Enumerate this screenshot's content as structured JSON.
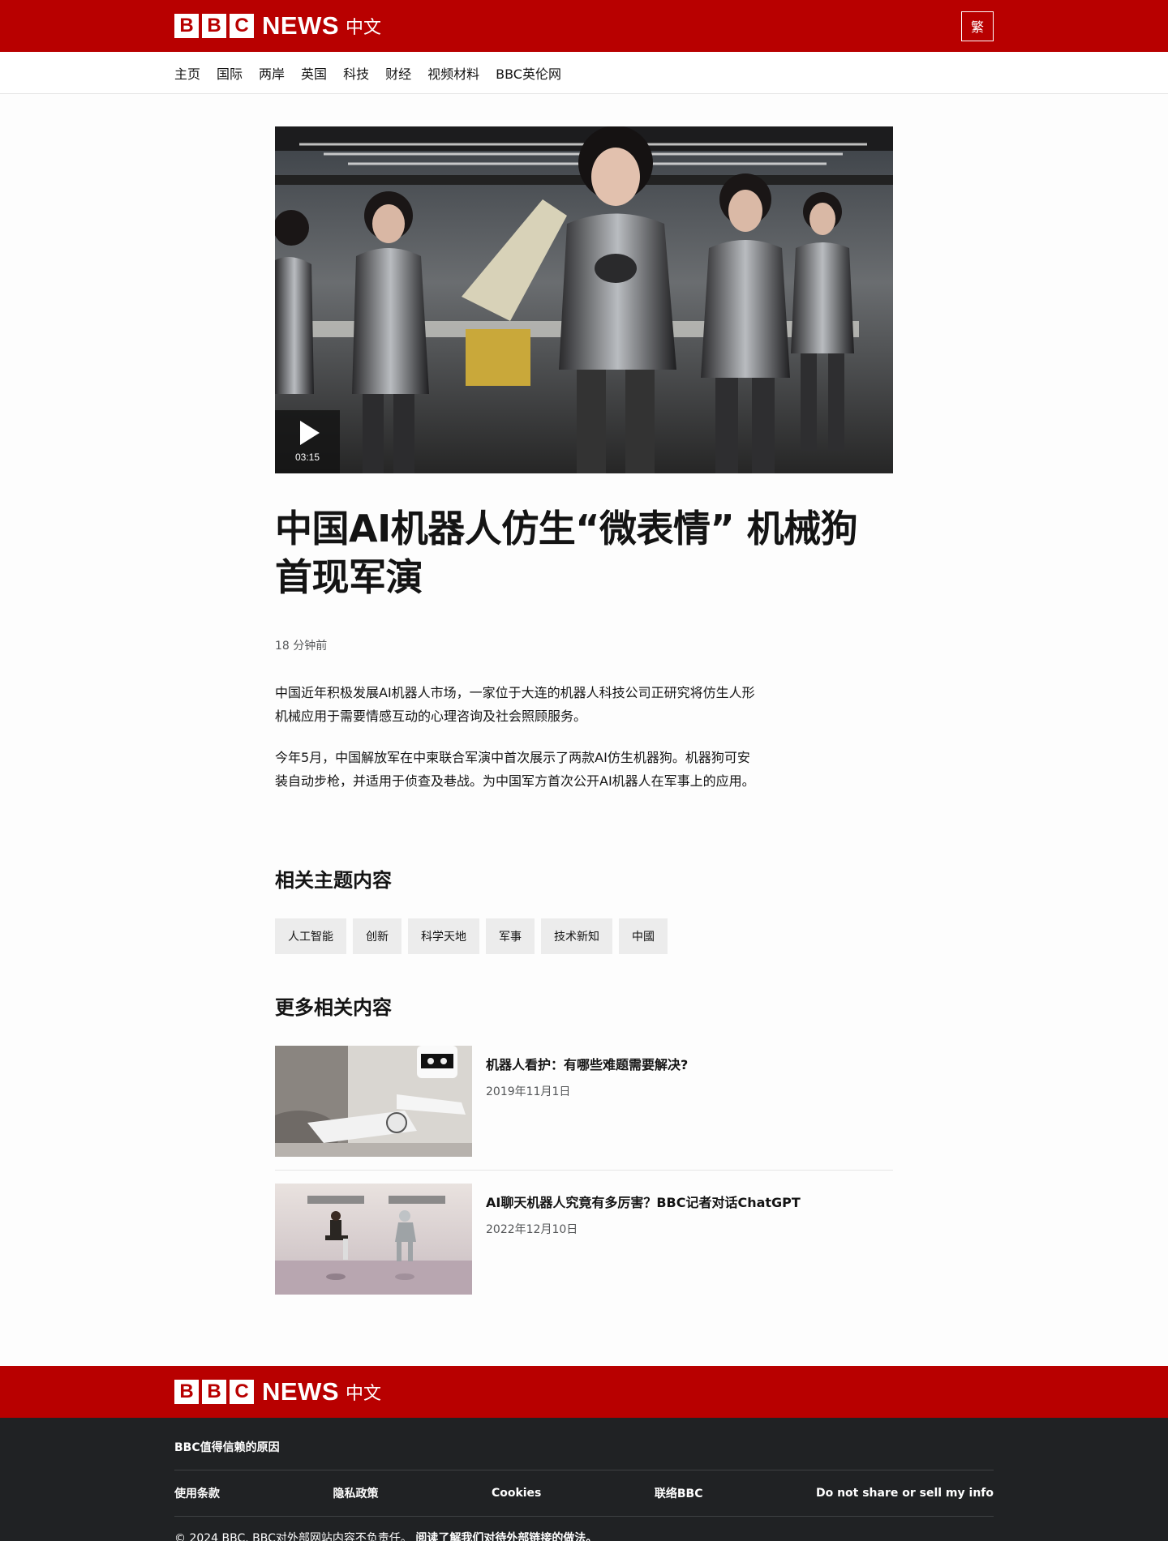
{
  "header": {
    "logo_blocks": [
      "B",
      "B",
      "C"
    ],
    "logo_news": "NEWS",
    "logo_lang": "中文",
    "traditional_button": "繁"
  },
  "nav": {
    "items": [
      "主页",
      "国际",
      "两岸",
      "英国",
      "科技",
      "财经",
      "视频材料",
      "BBC英伦网"
    ]
  },
  "article": {
    "video_duration": "03:15",
    "headline": "中国AI机器人仿生“微表情” 机械狗首现军演",
    "timestamp": "18 分钟前",
    "paragraphs": [
      "中国近年积极发展AI机器人市场，一家位于大连的机器人科技公司正研究将仿生人形机械应用于需要情感互动的心理咨询及社会照顾服务。",
      "今年5月，中国解放军在中柬联合军演中首次展示了两款AI仿生机器狗。机器狗可安装自动步枪，并适用于侦查及巷战。为中国军方首次公开AI机器人在军事上的应用。"
    ]
  },
  "topics": {
    "title": "相关主题内容",
    "tags": [
      "人工智能",
      "创新",
      "科学天地",
      "军事",
      "技术新知",
      "中國"
    ]
  },
  "more": {
    "title": "更多相关内容",
    "items": [
      {
        "title": "机器人看护：有哪些难题需要解决?",
        "date": "2019年11月1日"
      },
      {
        "title": "AI聊天机器人究竟有多厉害？BBC记者对话ChatGPT",
        "date": "2022年12月10日"
      }
    ]
  },
  "footer": {
    "logo_news": "NEWS",
    "logo_lang": "中文",
    "trust_link": "BBC值得信赖的原因",
    "links": [
      "使用条款",
      "隐私政策",
      "Cookies",
      "联络BBC",
      "Do not share or sell my info"
    ],
    "copyright": "© 2024 BBC. BBC对外部网站内容不负责任。",
    "external_link": "阅读了解我们对待外部链接的做法。"
  },
  "colors": {
    "brand_red": "#b80000",
    "footer_dark": "#202224",
    "tag_bg": "#ececec"
  }
}
